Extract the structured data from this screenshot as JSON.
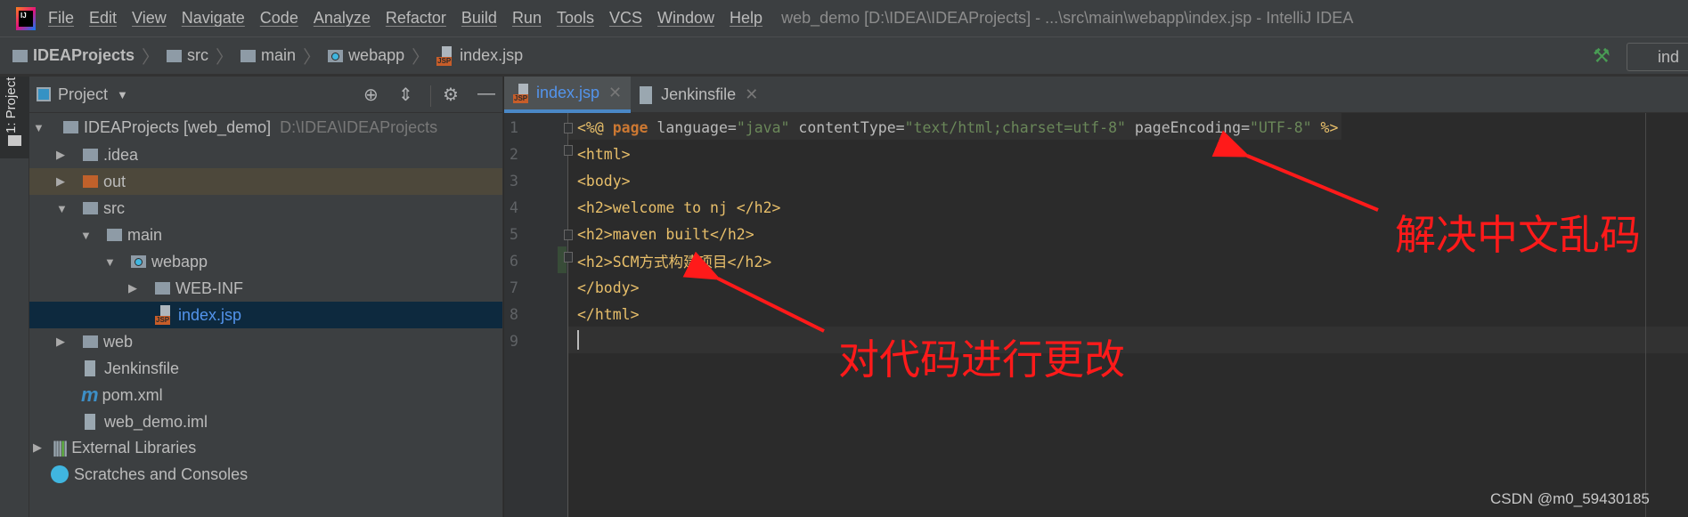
{
  "menubar": {
    "items": [
      "File",
      "Edit",
      "View",
      "Navigate",
      "Code",
      "Analyze",
      "Refactor",
      "Build",
      "Run",
      "Tools",
      "VCS",
      "Window",
      "Help"
    ],
    "title": "web_demo [D:\\IDEA\\IDEAProjects] - ...\\src\\main\\webapp\\index.jsp - IntelliJ IDEA"
  },
  "breadcrumb": [
    "IDEAProjects",
    "src",
    "main",
    "webapp",
    "index.jsp"
  ],
  "toolbar": {
    "run_config": "ind"
  },
  "stripe": {
    "label": "1: Project"
  },
  "panel": {
    "title": "Project"
  },
  "tree": [
    {
      "label": "IDEAProjects [web_demo]",
      "path": "D:\\IDEA\\IDEAProjects",
      "icon": "module-folder-icon",
      "expanded": true
    },
    {
      "label": ".idea",
      "icon": "folder-icon"
    },
    {
      "label": "out",
      "icon": "excluded-folder-icon"
    },
    {
      "label": "src",
      "icon": "folder-icon",
      "expanded": true
    },
    {
      "label": "main",
      "icon": "folder-icon",
      "expanded": true
    },
    {
      "label": "webapp",
      "icon": "web-folder-icon",
      "expanded": true
    },
    {
      "label": "WEB-INF",
      "icon": "folder-icon"
    },
    {
      "label": "index.jsp",
      "icon": "jsp-file-icon",
      "selected": true
    },
    {
      "label": "web",
      "icon": "folder-icon"
    },
    {
      "label": "Jenkinsfile",
      "icon": "text-file-icon"
    },
    {
      "label": "pom.xml",
      "icon": "maven-icon"
    },
    {
      "label": "web_demo.iml",
      "icon": "iml-file-icon"
    },
    {
      "label": "External Libraries",
      "icon": "libraries-icon"
    },
    {
      "label": "Scratches and Consoles",
      "icon": "scratches-icon"
    }
  ],
  "tabs": [
    {
      "label": "index.jsp",
      "active": true
    },
    {
      "label": "Jenkinsfile",
      "active": false
    }
  ],
  "editor": {
    "line_numbers": [
      "1",
      "2",
      "3",
      "4",
      "5",
      "6",
      "7",
      "8",
      "9"
    ],
    "line1": {
      "open": "<%@ ",
      "kw": "page",
      "a1": " language=",
      "v1": "\"java\"",
      "a2": " contentType=",
      "v2": "\"text/html;charset=utf-8\"",
      "a3": " pageEncoding=",
      "v3": "\"UTF-8\"",
      "close": " %>"
    },
    "lines": [
      "<html>",
      "<body>",
      "<h2>welcome to nj </h2>",
      "<h2>maven built</h2>",
      "<h2>SCM方式构建项目</h2>",
      "</body>",
      "</html>",
      ""
    ]
  },
  "annotations": {
    "encoding_note": "解决中文乱码",
    "change_note": "对代码进行更改",
    "color": "#ff1a1a"
  },
  "watermark": "CSDN @m0_59430185"
}
